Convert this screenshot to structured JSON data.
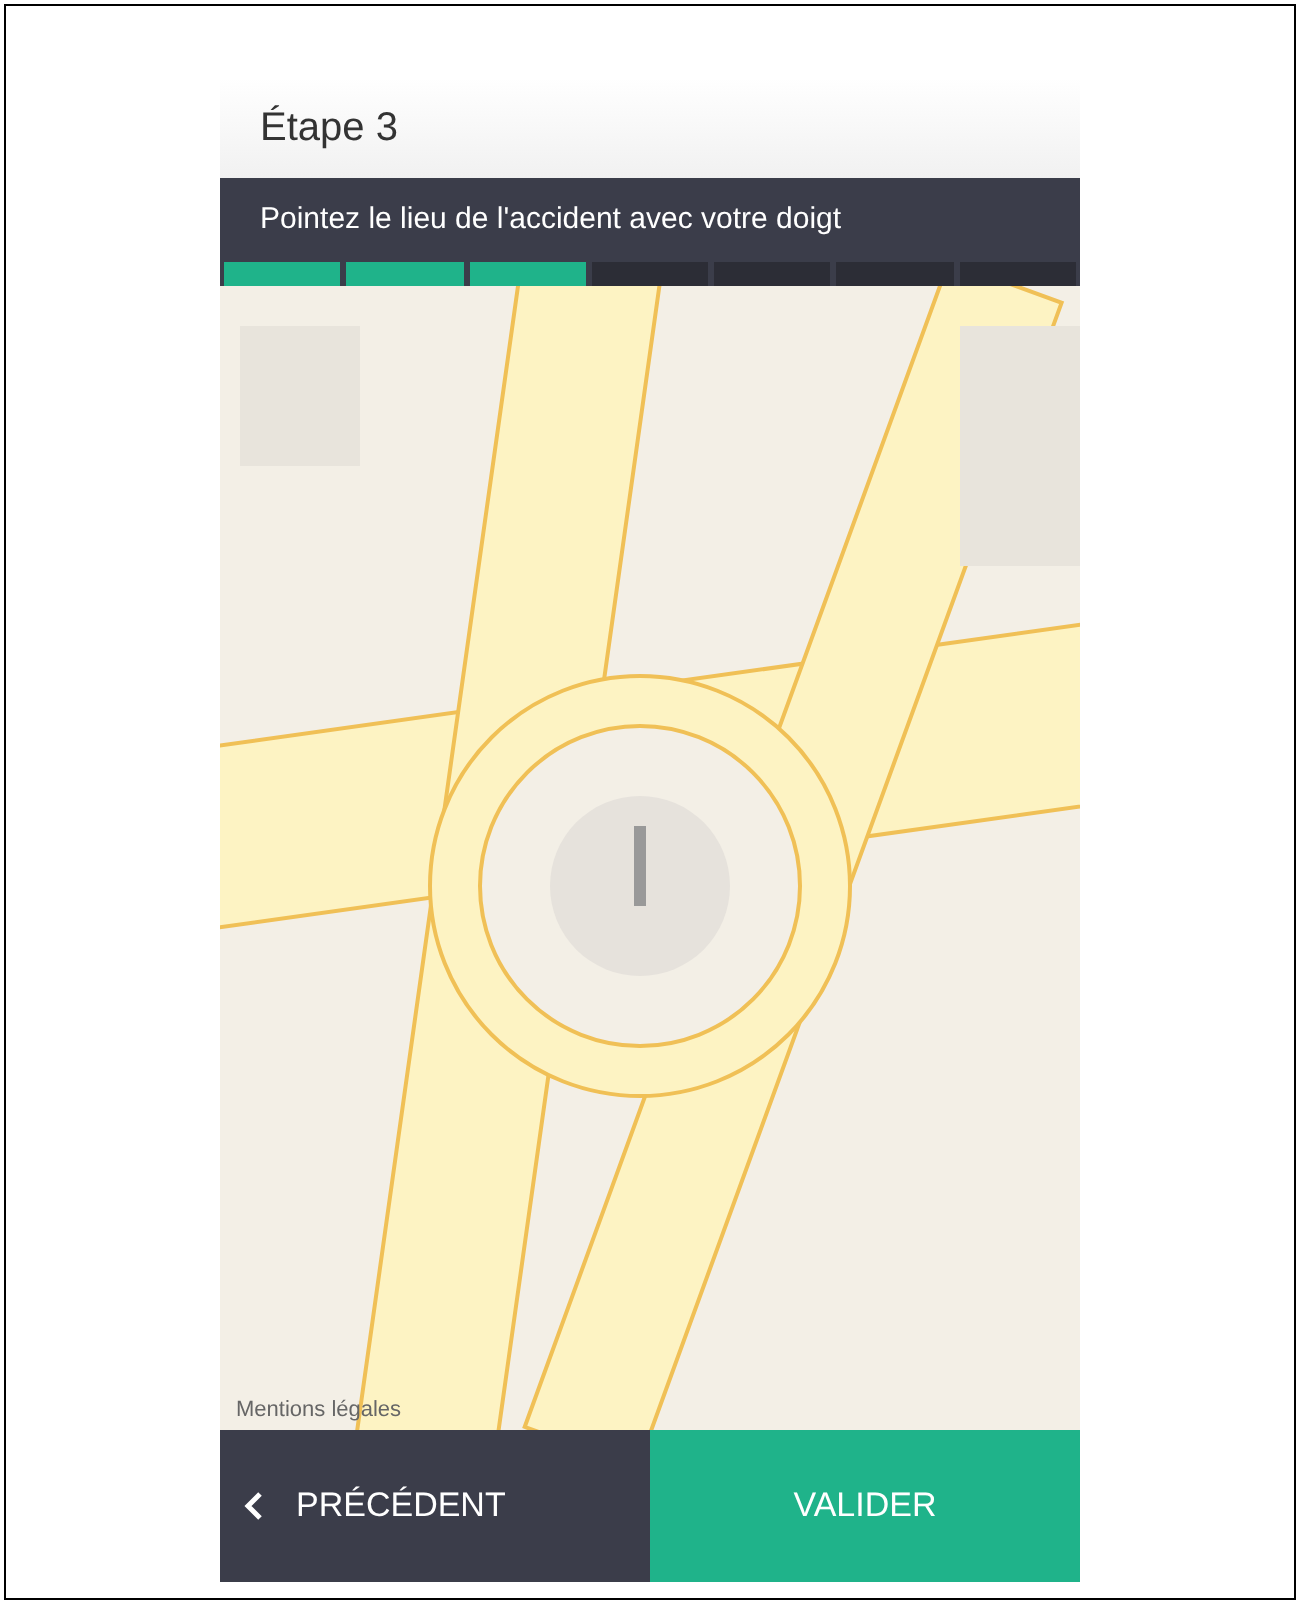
{
  "header": {
    "title": "Étape 3"
  },
  "instruction": "Pointez le lieu de l'accident avec votre doigt",
  "progress": [
    {
      "done": true
    },
    {
      "done": true
    },
    {
      "done": true
    },
    {
      "done": false
    },
    {
      "done": false
    },
    {
      "done": false
    },
    {
      "done": false
    }
  ],
  "map": {
    "legal_link": "Mentions légales"
  },
  "buttons": [
    {
      "kind": "back",
      "label": "PRÉCÉDENT"
    },
    {
      "kind": "confirm",
      "label": "VALIDER"
    }
  ]
}
